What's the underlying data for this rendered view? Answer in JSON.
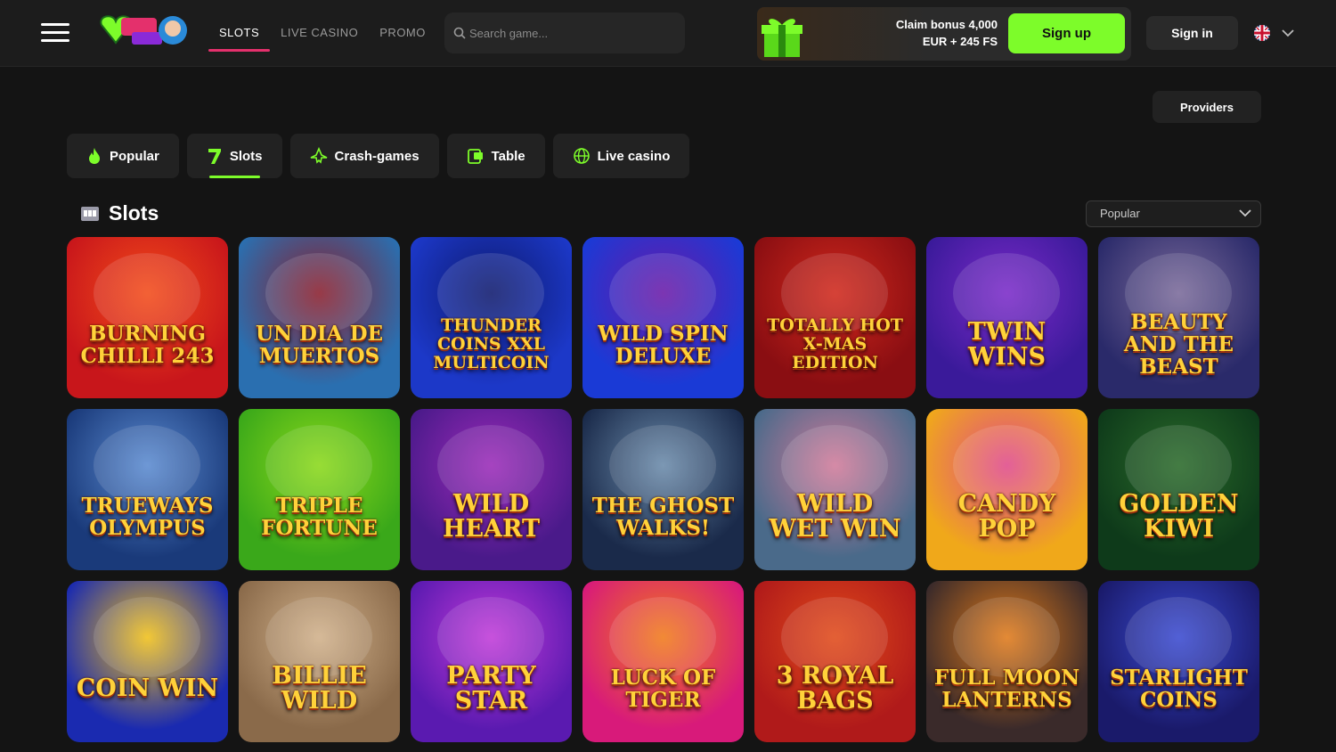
{
  "header": {
    "nav": [
      {
        "label": "SLOTS",
        "active": true
      },
      {
        "label": "LIVE CASINO",
        "active": false
      },
      {
        "label": "PROMO",
        "active": false
      }
    ],
    "search_placeholder": "Search game...",
    "promo_line1": "Claim bonus 4,000",
    "promo_line2": "EUR + 245 FS",
    "signup_label": "Sign up",
    "signin_label": "Sign in",
    "language_flag": "uk-flag-icon"
  },
  "providers_label": "Providers",
  "categories": [
    {
      "label": "Popular",
      "icon": "flame-icon",
      "active": false
    },
    {
      "label": "Slots",
      "icon": "seven-icon",
      "active": true
    },
    {
      "label": "Crash-games",
      "icon": "plane-icon",
      "active": false
    },
    {
      "label": "Table",
      "icon": "cards-icon",
      "active": false
    },
    {
      "label": "Live casino",
      "icon": "globe-icon",
      "active": false
    }
  ],
  "section": {
    "title": "Slots",
    "sort_value": "Popular"
  },
  "games": [
    {
      "title": "Burning Chilli 243",
      "bg": "#c8161b",
      "bg2": "#f24b1a"
    },
    {
      "title": "Un Dia de Muertos",
      "bg": "#2a6fb0",
      "bg2": "#8a1f2e"
    },
    {
      "title": "Thunder Coins XXL Multicoin",
      "bg": "#1c38c8",
      "bg2": "#0e1a6e"
    },
    {
      "title": "Wild Spin Deluxe",
      "bg": "#1a3ad6",
      "bg2": "#6a1aa8"
    },
    {
      "title": "Totally Hot X-Mas Edition",
      "bg": "#8a0e12",
      "bg2": "#d0281c"
    },
    {
      "title": "Twin Wins",
      "bg": "#3a1a9a",
      "bg2": "#7a2ac8"
    },
    {
      "title": "Beauty and the Beast",
      "bg": "#2a2a6a",
      "bg2": "#7a6a9a"
    },
    {
      "title": "Trueways Olympus",
      "bg": "#1a3a7a",
      "bg2": "#5a8ad0"
    },
    {
      "title": "Triple Fortune",
      "bg": "#3aa81a",
      "bg2": "#8ad81a"
    },
    {
      "title": "Wild Heart",
      "bg": "#4a1a8a",
      "bg2": "#9a2ab8"
    },
    {
      "title": "The Ghost Walks!",
      "bg": "#1a2a4a",
      "bg2": "#6a8aaa"
    },
    {
      "title": "Wild Wet Win",
      "bg": "#4a6a8a",
      "bg2": "#d07a9a"
    },
    {
      "title": "Candy Pop",
      "bg": "#f0a81a",
      "bg2": "#e04a8a"
    },
    {
      "title": "Golden Kiwi",
      "bg": "#0e3a1a",
      "bg2": "#2a6a2a"
    },
    {
      "title": "Coin Win",
      "bg": "#1a2ab0",
      "bg2": "#f0c01a"
    },
    {
      "title": "Billie Wild",
      "bg": "#8a6a4a",
      "bg2": "#d0b08a"
    },
    {
      "title": "Party Star",
      "bg": "#5a1ab0",
      "bg2": "#c03ad8"
    },
    {
      "title": "Luck of Tiger",
      "bg": "#d81a7a",
      "bg2": "#f07a1a"
    },
    {
      "title": "3 Royal Bags",
      "bg": "#b01a1a",
      "bg2": "#e04a1a"
    },
    {
      "title": "Full Moon Lanterns",
      "bg": "#3a2a2a",
      "bg2": "#e07a1a"
    },
    {
      "title": "Starlight Coins",
      "bg": "#1a1a6a",
      "bg2": "#3a4ad0"
    }
  ]
}
